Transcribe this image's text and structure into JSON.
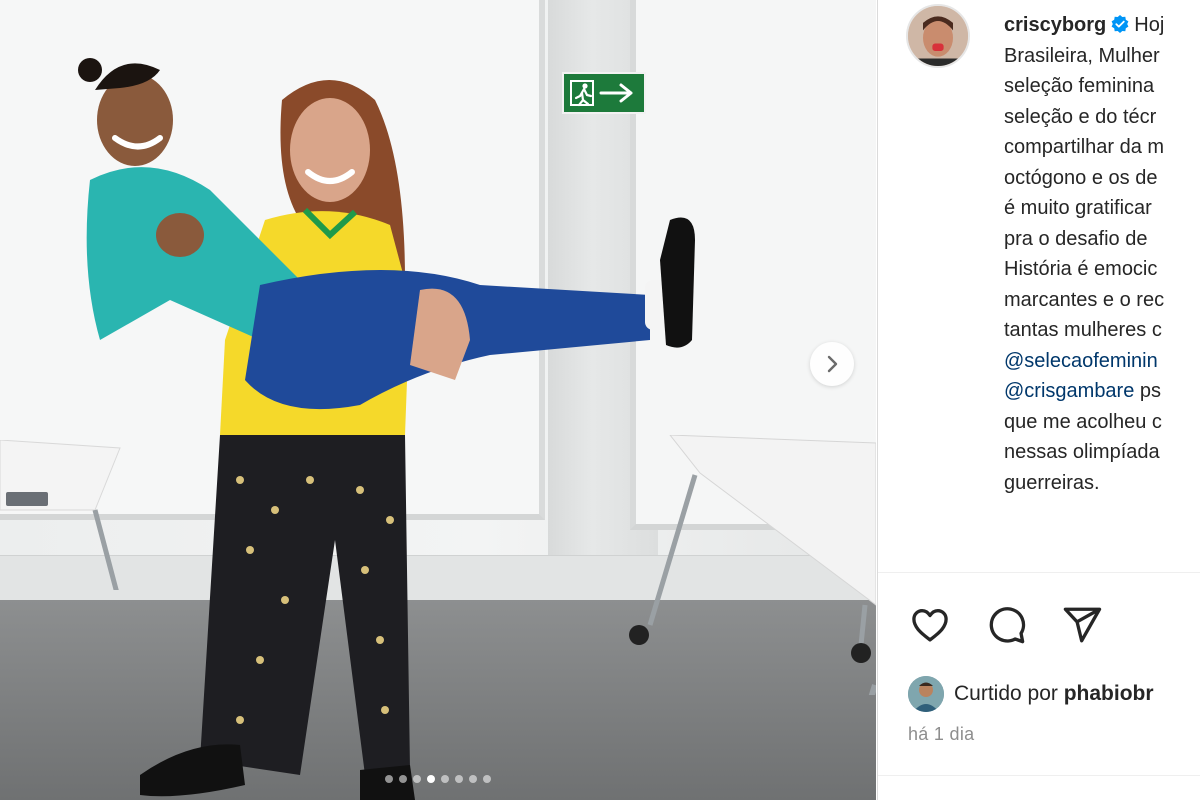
{
  "post": {
    "username": "criscyborg",
    "caption_lines": [
      "Hoj",
      "Brasileira, Mulher",
      "seleção feminina",
      "seleção e do técr",
      "compartilhar da m",
      "octógono e os de",
      "é muito gratificar",
      "pra o desafio de",
      "História é emocic",
      "marcantes e o rec",
      "tantas mulheres c"
    ],
    "mention_1": "@selecaofeminin",
    "mention_2": "@crisgambare",
    "mention_2_suffix": " ps",
    "caption_tail_lines": [
      "que me acolheu c",
      "nessas olimpíada",
      "guerreiras."
    ]
  },
  "likes": {
    "prefix": "Curtido por ",
    "name": "phabiobr"
  },
  "time_ago": "há 1 dia",
  "carousel": {
    "total": 8,
    "active_index": 3
  },
  "icons": {
    "like": "heart-icon",
    "comment": "comment-icon",
    "share": "paper-plane-icon",
    "next": "chevron-right-icon",
    "verified": "verified-badge-icon"
  },
  "colors": {
    "verified_blue": "#0095f6",
    "mention": "#00376b",
    "muted": "#8e8e8e",
    "exit_green": "#1d7a3b"
  }
}
